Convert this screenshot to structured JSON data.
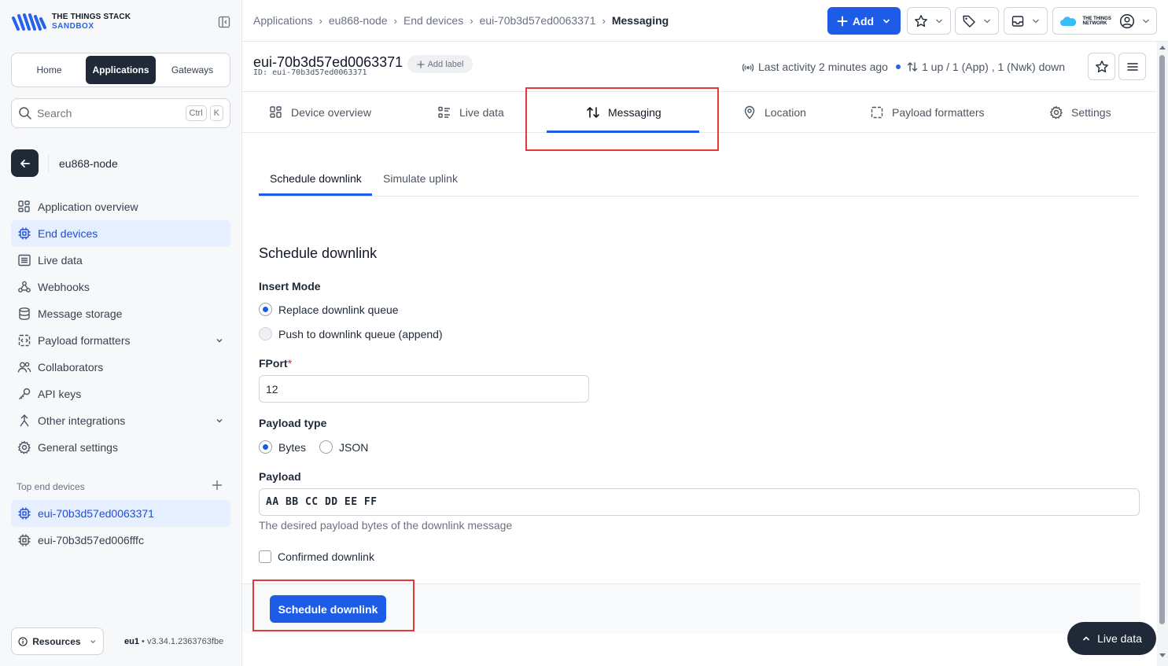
{
  "brand": {
    "line1": "THE THINGS STACK",
    "line2": "SANDBOX"
  },
  "sidebar": {
    "segments": [
      "Home",
      "Applications",
      "Gateways"
    ],
    "active_segment": "Applications",
    "search": {
      "placeholder": "Search",
      "shortcut_1": "Ctrl",
      "shortcut_2": "K"
    },
    "app_name": "eu868-node",
    "items": [
      {
        "label": "Application overview",
        "icon": "grid-icon"
      },
      {
        "label": "End devices",
        "icon": "chip-icon",
        "active": true
      },
      {
        "label": "Live data",
        "icon": "list-icon"
      },
      {
        "label": "Webhooks",
        "icon": "webhook-icon"
      },
      {
        "label": "Message storage",
        "icon": "database-icon"
      },
      {
        "label": "Payload formatters",
        "icon": "code-icon",
        "expandable": true
      },
      {
        "label": "Collaborators",
        "icon": "people-icon"
      },
      {
        "label": "API keys",
        "icon": "key-icon"
      },
      {
        "label": "Other integrations",
        "icon": "integration-icon",
        "expandable": true
      },
      {
        "label": "General settings",
        "icon": "gear-icon"
      }
    ],
    "top_devices_title": "Top end devices",
    "top_devices": [
      {
        "label": "eui-70b3d57ed0063371",
        "active": true
      },
      {
        "label": "eui-70b3d57ed006fffc"
      }
    ],
    "resources_label": "Resources",
    "cluster": "eu1",
    "version": "v3.34.1.2363763fbe"
  },
  "topbar": {
    "breadcrumbs": [
      "Applications",
      "eu868-node",
      "End devices",
      "eui-70b3d57ed0063371",
      "Messaging"
    ],
    "add_label": "Add",
    "network_logo_text": "THE THINGS NETWORK"
  },
  "device": {
    "title": "eui-70b3d57ed0063371",
    "id_line": "ID: eui-70b3d57ed0063371",
    "add_label": "Add label",
    "last_activity": "Last activity 2 minutes ago",
    "traffic": "1 up / 1 (App) , 1 (Nwk) down"
  },
  "tabs": [
    {
      "label": "Device overview",
      "icon": "grid-icon"
    },
    {
      "label": "Live data",
      "icon": "list-icon"
    },
    {
      "label": "Messaging",
      "icon": "arrows-updown-icon",
      "active": true
    },
    {
      "label": "Location",
      "icon": "pin-icon"
    },
    {
      "label": "Payload formatters",
      "icon": "code-icon"
    },
    {
      "label": "Settings",
      "icon": "gear-icon"
    }
  ],
  "subtabs": [
    {
      "label": "Schedule downlink",
      "active": true
    },
    {
      "label": "Simulate uplink"
    }
  ],
  "form": {
    "title": "Schedule downlink",
    "insert_mode_label": "Insert Mode",
    "insert_mode_options": [
      "Replace downlink queue",
      "Push to downlink queue (append)"
    ],
    "insert_mode_selected": "Replace downlink queue",
    "fport_label": "FPort",
    "fport_required_mark": "*",
    "fport_value": "12",
    "payload_type_label": "Payload type",
    "payload_type_options": [
      "Bytes",
      "JSON"
    ],
    "payload_type_selected": "Bytes",
    "payload_label": "Payload",
    "payload_value": "AA BB CC DD EE FF",
    "payload_hint": "The desired payload bytes of the downlink message",
    "confirmed_label": "Confirmed downlink",
    "confirmed_checked": false,
    "submit_label": "Schedule downlink"
  },
  "live_data_pill": "Live data",
  "colors": {
    "primary": "#1d5ce6",
    "dark": "#1f2937",
    "highlight": "#e53935",
    "active_bg": "#e6efff"
  }
}
